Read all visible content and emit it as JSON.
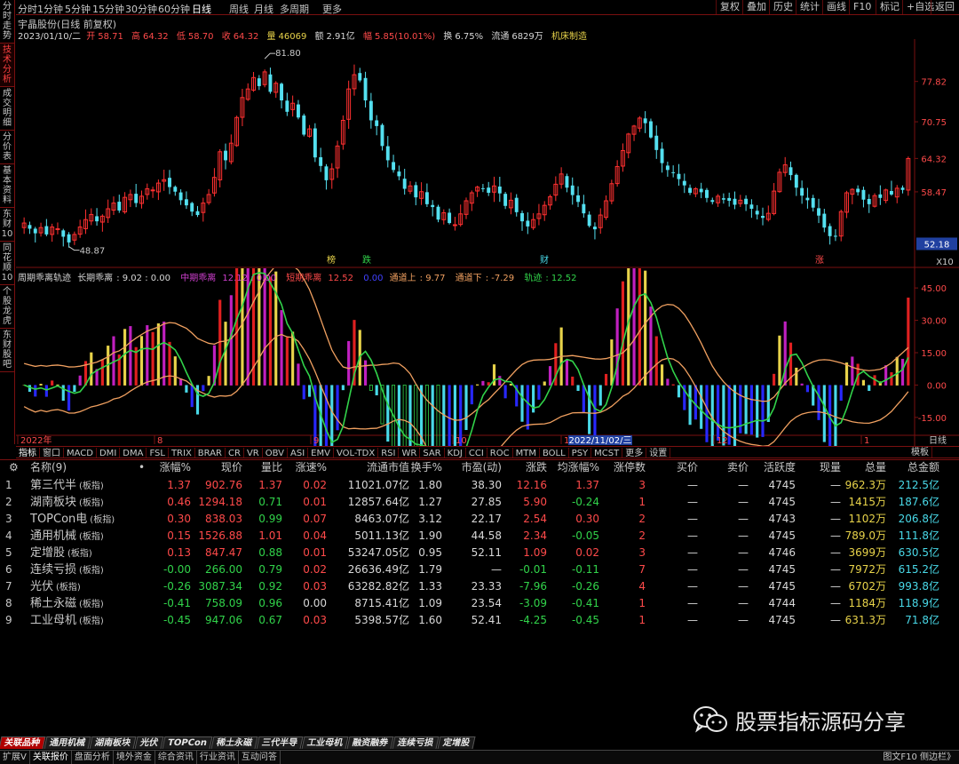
{
  "left_tabs": [
    "分时走势",
    "技术分析",
    "成交明细",
    "分价表",
    "基本资料",
    "东财10",
    "同花顺10",
    "个股龙虎",
    "东财股吧"
  ],
  "left_active": 1,
  "periods": [
    "分时",
    "1分钟",
    "5分钟",
    "15分钟",
    "30分钟",
    "60分钟",
    "日线",
    "周线",
    "月线",
    "多周期",
    "更多"
  ],
  "period_active": 6,
  "toolbar_right": [
    "复权",
    "叠加",
    "历史",
    "统计",
    "画线",
    "F10",
    "标记",
    "+自选",
    "返回"
  ],
  "stock_title": "宇晶股份(日线 前复权)",
  "quote": {
    "date": "2023/01/10/二",
    "open_label": "开",
    "open": "58.71",
    "high_label": "高",
    "high": "64.32",
    "low_label": "低",
    "low": "58.70",
    "close_label": "收",
    "close": "64.32",
    "vol_label": "量",
    "vol": "46069",
    "amt_label": "额",
    "amt": "2.91亿",
    "chg_label": "幅",
    "chg": "5.85(10.01%)",
    "turn_label": "换",
    "turn": "6.75%",
    "float_label": "流通",
    "float": "6829万",
    "industry": "机床制造"
  },
  "price_axis": {
    "labels": [
      "77.82",
      "70.75",
      "64.32",
      "58.47"
    ],
    "current": "52.18",
    "zoom": "X10"
  },
  "price_annotations": {
    "high": "81.80",
    "low": "48.87",
    "markers": [
      "榜",
      "跌",
      "财",
      "涨"
    ]
  },
  "indicator": {
    "name": "周期乖离轨迹",
    "long_label": "长期乖离",
    "long_value": "9.02 : 0.00",
    "mid_label": "中期乖离",
    "mid_value": "12.12 : 0.00",
    "short_label": "短期乖离",
    "short_value": "12.52",
    "short_extra": "0.00",
    "up_label": "通道上",
    "up_value": "9.77",
    "down_label": "通道下",
    "down_value": "-7.29",
    "track_label": "轨迹",
    "track_value": "12.52",
    "axis": [
      "45.00",
      "30.00",
      "15.00",
      "0.00",
      "-15.00"
    ]
  },
  "time_axis": {
    "labels": [
      "2022年",
      "8",
      "9",
      "10",
      "11",
      "12",
      "1"
    ],
    "cursor": "2022/11/02/三",
    "right": "日线"
  },
  "indicator_tabs": [
    "指标",
    "窗口",
    "MACD",
    "DMI",
    "DMA",
    "FSL",
    "TRIX",
    "BRAR",
    "CR",
    "VR",
    "OBV",
    "ASI",
    "EMV",
    "VOL-TDX",
    "RSI",
    "WR",
    "SAR",
    "KDJ",
    "CCI",
    "ROC",
    "MTM",
    "BOLL",
    "PSY",
    "MCST",
    "更多",
    "设置"
  ],
  "indicator_tabs_right": "模板",
  "table": {
    "headers": [
      "名称(9)",
      "•",
      "涨幅%",
      "现价",
      "量比",
      "涨速%",
      "流通市值",
      "换手%",
      "市盈(动)",
      "涨跌",
      "均涨幅%",
      "涨停数",
      "买价",
      "卖价",
      "活跃度",
      "现量",
      "总量",
      "总金额"
    ],
    "rows": [
      {
        "idx": "1",
        "name": "第三代半",
        "tag": "(板指)",
        "chg": "1.37",
        "price": "902.76",
        "vr": "1.37",
        "spd": "0.02",
        "mcap": "11021.07亿",
        "turn": "1.80",
        "pe": "38.30",
        "diff": "12.16",
        "avg": "1.37",
        "lim": "3",
        "bid": "—",
        "ask": "—",
        "act": "4745",
        "cur": "—",
        "vol": "962.3万",
        "amt": "212.5亿",
        "dir": "up"
      },
      {
        "idx": "2",
        "name": "湖南板块",
        "tag": "(板指)",
        "chg": "0.46",
        "price": "1294.18",
        "vr": "0.71",
        "spd": "0.01",
        "mcap": "12857.64亿",
        "turn": "1.27",
        "pe": "27.85",
        "diff": "5.90",
        "avg": "-0.24",
        "lim": "1",
        "bid": "—",
        "ask": "—",
        "act": "4745",
        "cur": "—",
        "vol": "1415万",
        "amt": "187.6亿",
        "dir": "up"
      },
      {
        "idx": "3",
        "name": "TOPCon电",
        "tag": "(板指)",
        "chg": "0.30",
        "price": "838.03",
        "vr": "0.99",
        "spd": "0.07",
        "mcap": "8463.07亿",
        "turn": "3.12",
        "pe": "22.17",
        "diff": "2.54",
        "avg": "0.30",
        "lim": "2",
        "bid": "—",
        "ask": "—",
        "act": "4743",
        "cur": "—",
        "vol": "1102万",
        "amt": "206.8亿",
        "dir": "up"
      },
      {
        "idx": "4",
        "name": "通用机械",
        "tag": "(板指)",
        "chg": "0.15",
        "price": "1526.88",
        "vr": "1.01",
        "spd": "0.04",
        "mcap": "5011.13亿",
        "turn": "1.90",
        "pe": "44.58",
        "diff": "2.34",
        "avg": "-0.05",
        "lim": "2",
        "bid": "—",
        "ask": "—",
        "act": "4745",
        "cur": "—",
        "vol": "789.0万",
        "amt": "111.8亿",
        "dir": "up"
      },
      {
        "idx": "5",
        "name": "定增股",
        "tag": "(板指)",
        "chg": "0.13",
        "price": "847.47",
        "vr": "0.88",
        "spd": "0.01",
        "mcap": "53247.05亿",
        "turn": "0.95",
        "pe": "52.11",
        "diff": "1.09",
        "avg": "0.02",
        "lim": "3",
        "bid": "—",
        "ask": "—",
        "act": "4746",
        "cur": "—",
        "vol": "3699万",
        "amt": "630.5亿",
        "dir": "up"
      },
      {
        "idx": "6",
        "name": "连续亏损",
        "tag": "(板指)",
        "chg": "-0.00",
        "price": "266.00",
        "vr": "0.79",
        "spd": "0.02",
        "mcap": "26636.49亿",
        "turn": "1.79",
        "pe": "—",
        "diff": "-0.01",
        "avg": "-0.11",
        "lim": "7",
        "bid": "—",
        "ask": "—",
        "act": "4745",
        "cur": "—",
        "vol": "7972万",
        "amt": "615.2亿",
        "dir": "dn"
      },
      {
        "idx": "7",
        "name": "光伏",
        "tag": "(板指)",
        "chg": "-0.26",
        "price": "3087.34",
        "vr": "0.92",
        "spd": "0.03",
        "mcap": "63282.82亿",
        "turn": "1.33",
        "pe": "23.33",
        "diff": "-7.96",
        "avg": "-0.26",
        "lim": "4",
        "bid": "—",
        "ask": "—",
        "act": "4745",
        "cur": "—",
        "vol": "6702万",
        "amt": "993.8亿",
        "dir": "dn"
      },
      {
        "idx": "8",
        "name": "稀土永磁",
        "tag": "(板指)",
        "chg": "-0.41",
        "price": "758.09",
        "vr": "0.96",
        "spd": "0.00",
        "mcap": "8715.41亿",
        "turn": "1.09",
        "pe": "23.54",
        "diff": "-3.09",
        "avg": "-0.41",
        "lim": "1",
        "bid": "—",
        "ask": "—",
        "act": "4744",
        "cur": "—",
        "vol": "1184万",
        "amt": "118.9亿",
        "dir": "dn"
      },
      {
        "idx": "9",
        "name": "工业母机",
        "tag": "(板指)",
        "chg": "-0.45",
        "price": "947.06",
        "vr": "0.67",
        "spd": "0.03",
        "mcap": "5398.57亿",
        "turn": "1.60",
        "pe": "52.41",
        "diff": "-4.25",
        "avg": "-0.45",
        "lim": "1",
        "bid": "—",
        "ask": "—",
        "act": "4745",
        "cur": "—",
        "vol": "631.3万",
        "amt": "71.8亿",
        "dir": "dn"
      }
    ]
  },
  "watermark": {
    "text": "股票指标源码分享",
    "icon": "wechat-icon"
  },
  "sector_tabs": [
    "关联品种",
    "通用机械",
    "湖南板块",
    "光伏",
    "TOPCon",
    "稀土永磁",
    "三代半导",
    "工业母机",
    "融资融券",
    "连续亏损",
    "定增股"
  ],
  "sector_active": 0,
  "status_tabs": [
    "扩展V",
    "关联报价",
    "盘面分析",
    "境外资金",
    "综合资讯",
    "行业资讯",
    "互动问答"
  ],
  "status_active": 1,
  "status_right": "图文F10 侧边栏》",
  "colors": {
    "up": "#ff4a4a",
    "down": "#31d34a",
    "cyan": "#49d9e8",
    "yellow": "#e8d34a",
    "magenta": "#c020c0",
    "orange": "#f0a060",
    "accent": "#b00000"
  },
  "chart_data": {
    "type": "candlestick",
    "title": "宇晶股份(日线 前复权)",
    "ylim": [
      46,
      84
    ],
    "y_ticks": [
      58.47,
      64.32,
      70.75,
      77.82
    ],
    "x_months": [
      "2022年",
      "8",
      "9",
      "10",
      "11",
      "12",
      "1"
    ],
    "high_mark": 81.8,
    "low_mark": 48.87,
    "last_close": 64.32,
    "closes": [
      53.0,
      52.0,
      51.2,
      52.2,
      51.0,
      52.3,
      52.0,
      50.6,
      49.6,
      51.0,
      52.3,
      53.6,
      54.5,
      53.3,
      54.2,
      55.5,
      56.5,
      55.2,
      57.5,
      58.0,
      56.5,
      57.7,
      59.0,
      58.8,
      60.0,
      60.6,
      59.3,
      58.5,
      57.0,
      56.1,
      55.0,
      54.4,
      56.5,
      58.0,
      61.0,
      65.5,
      64.0,
      67.0,
      71.5,
      75.0,
      76.5,
      78.5,
      77.0,
      79.5,
      76.0,
      77.5,
      74.5,
      72.5,
      74.0,
      71.5,
      68.5,
      69.5,
      64.5,
      63.0,
      60.5,
      62.5,
      66.5,
      71.0,
      76.5,
      79.0,
      78.0,
      74.5,
      71.0,
      70.0,
      66.5,
      64.0,
      62.3,
      61.2,
      59.0,
      59.5,
      57.5,
      58.5,
      56.3,
      55.8,
      53.6,
      54.8,
      53.0,
      52.7,
      54.6,
      56.9,
      58.3,
      59.3,
      59.0,
      58.3,
      59.5,
      58.2,
      56.0,
      57.0,
      54.9,
      53.3,
      52.4,
      53.6,
      54.6,
      56.1,
      57.6,
      59.8,
      61.6,
      59.2,
      57.9,
      56.7,
      54.7,
      52.5,
      51.9,
      54.4,
      56.9,
      59.9,
      62.9,
      65.7,
      68.6,
      70.0,
      71.4,
      70.5,
      68.0,
      65.8,
      63.5,
      62.3,
      61.8,
      60.7,
      59.6,
      58.3,
      59.0,
      58.4,
      57.4,
      56.7,
      57.7,
      57.1,
      56.9,
      56.2,
      57.0,
      56.3,
      55.5,
      54.5,
      53.9,
      54.7,
      58.6,
      61.9,
      63.2,
      61.4,
      59.2,
      57.8,
      57.0,
      55.7,
      54.3,
      52.2,
      50.7,
      50.6,
      55.0,
      58.3,
      58.9,
      58.4,
      57.1,
      56.3,
      57.8,
      57.4,
      58.8,
      58.0,
      59.1,
      58.8,
      64.3
    ]
  },
  "indicator_data": {
    "type": "histogram+lines",
    "ylim": [
      -20,
      50
    ],
    "y_ticks": [
      45,
      30,
      15,
      0,
      -15
    ]
  }
}
